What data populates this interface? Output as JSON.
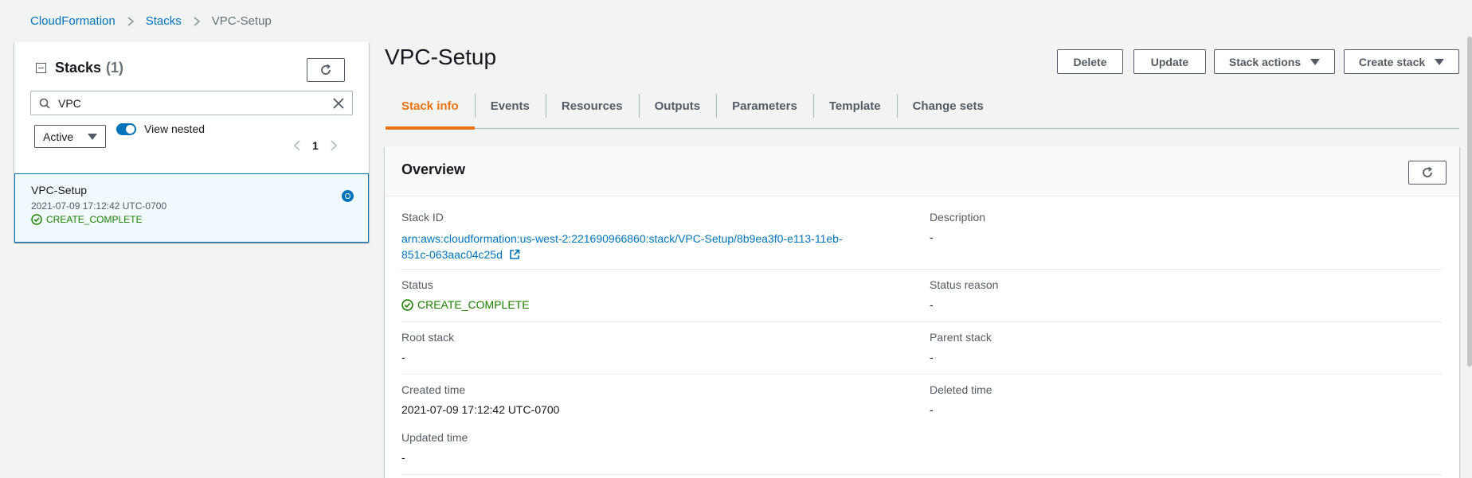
{
  "breadcrumb": {
    "items": [
      {
        "label": "CloudFormation"
      },
      {
        "label": "Stacks"
      },
      {
        "label": "VPC-Setup"
      }
    ]
  },
  "left_panel": {
    "title": "Stacks",
    "count": "(1)",
    "search": {
      "value": "VPC",
      "icon": "search-icon"
    },
    "filter": {
      "selected": "Active"
    },
    "toggle": {
      "label": "View nested",
      "on": true
    },
    "pagination": {
      "current_page": "1"
    },
    "stacks": [
      {
        "name": "VPC-Setup",
        "created": "2021-07-09 17:12:42 UTC-0700",
        "status": "CREATE_COMPLETE",
        "selected": true
      }
    ]
  },
  "page": {
    "title": "VPC-Setup",
    "actions": {
      "delete": "Delete",
      "update": "Update",
      "stack_actions": "Stack actions",
      "create_stack": "Create stack"
    },
    "tabs": [
      {
        "label": "Stack info",
        "active": true
      },
      {
        "label": "Events"
      },
      {
        "label": "Resources"
      },
      {
        "label": "Outputs"
      },
      {
        "label": "Parameters"
      },
      {
        "label": "Template"
      },
      {
        "label": "Change sets"
      }
    ]
  },
  "overview": {
    "title": "Overview",
    "stack_id_label": "Stack ID",
    "stack_id_line1": "arn:aws:cloudformation:us-west-2:221690966860:stack/VPC-Setup/8b9ea3f0-e113-11eb-",
    "stack_id_line2": "851c-063aac04c25d",
    "description_label": "Description",
    "description_value": "-",
    "status_label": "Status",
    "status_value": "CREATE_COMPLETE",
    "status_reason_label": "Status reason",
    "status_reason_value": "-",
    "root_stack_label": "Root stack",
    "root_stack_value": "-",
    "parent_stack_label": "Parent stack",
    "parent_stack_value": "-",
    "created_time_label": "Created time",
    "created_time_value": "2021-07-09 17:12:42 UTC-0700",
    "deleted_time_label": "Deleted time",
    "deleted_time_value": "-",
    "updated_time_label": "Updated time",
    "updated_time_value": "-"
  },
  "colors": {
    "link": "#0073bb",
    "success": "#1d8102",
    "active_tab": "#ec7211"
  }
}
